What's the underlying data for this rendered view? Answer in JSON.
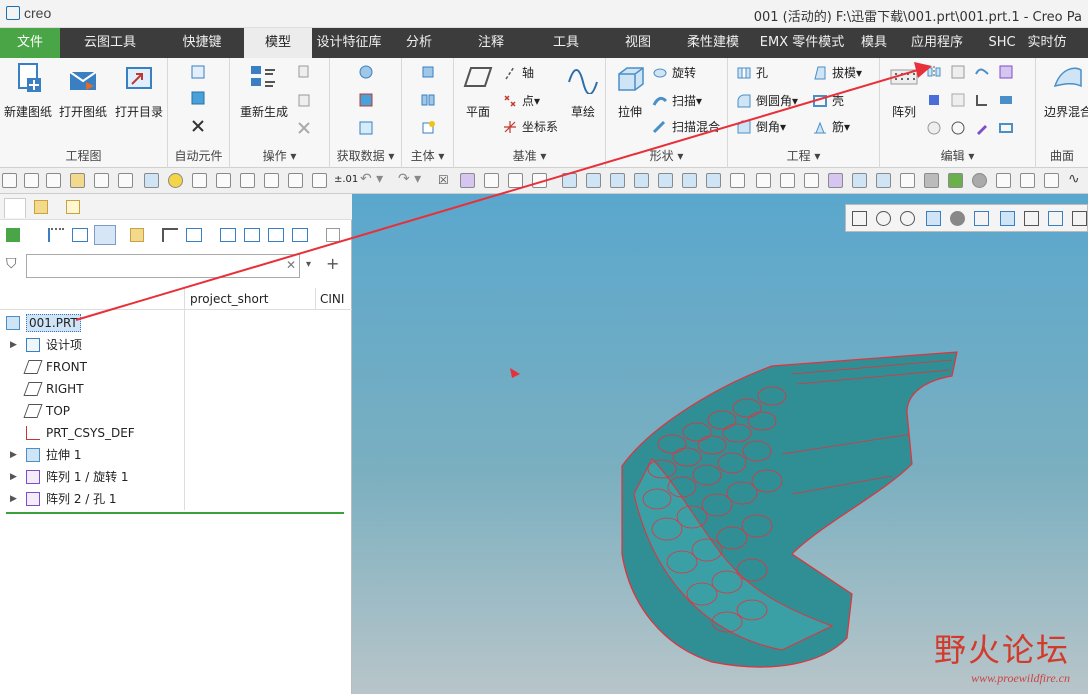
{
  "app": {
    "logo_text": "creo",
    "window_title": "001 (活动的) F:\\迅雷下载\\001.prt\\001.prt.1 - Creo Pa"
  },
  "tabs": [
    {
      "label": "文件"
    },
    {
      "label": "云图工具"
    },
    {
      "label": "快捷键"
    },
    {
      "label": "模型"
    },
    {
      "label": "设计特征库"
    },
    {
      "label": "分析"
    },
    {
      "label": "注释"
    },
    {
      "label": "工具"
    },
    {
      "label": "视图"
    },
    {
      "label": "柔性建模"
    },
    {
      "label": "EMX 零件模式"
    },
    {
      "label": "模具"
    },
    {
      "label": "应用程序"
    },
    {
      "label": "SHC"
    },
    {
      "label": "实时仿"
    }
  ],
  "ribbon": {
    "drawing": {
      "label": "工程图",
      "new": "新建图纸",
      "open": "打开图纸",
      "dir": "打开目录"
    },
    "auto": {
      "label": "自动元件"
    },
    "ops": {
      "label": "操作",
      "regen": "重新生成"
    },
    "getdata": {
      "label": "获取数据"
    },
    "body": {
      "label": "主体"
    },
    "datum": {
      "label": "基准",
      "plane": "平面",
      "axis": "轴",
      "point": "点",
      "csys": "坐标系",
      "sketch": "草绘"
    },
    "shapes": {
      "label": "形状",
      "extrude": "拉伸",
      "revolve": "旋转",
      "sweep": "扫描",
      "swept_blend": "扫描混合"
    },
    "eng": {
      "label": "工程",
      "hole": "孔",
      "round": "倒圆角",
      "chamfer": "倒角",
      "draft": "拔模",
      "shell": "壳",
      "rib": "筋"
    },
    "edit": {
      "label": "编辑",
      "pattern": "阵列"
    },
    "surface": {
      "label": "曲面",
      "boundary": "边界混合"
    }
  },
  "toolbar2": {
    "regen_val": "±.01"
  },
  "leftpane": {
    "filter_placeholder": "",
    "columns": [
      "project_short",
      "CINI"
    ],
    "tree": [
      {
        "label": "001.PRT"
      },
      {
        "label": "设计项"
      },
      {
        "label": "FRONT"
      },
      {
        "label": "RIGHT"
      },
      {
        "label": "TOP"
      },
      {
        "label": "PRT_CSYS_DEF"
      },
      {
        "label": "拉伸 1"
      },
      {
        "label": "阵列 1 / 旋转 1"
      },
      {
        "label": "阵列 2 / 孔 1"
      }
    ]
  },
  "watermark": {
    "main": "野火论坛",
    "sub": "www.proewildfire.cn"
  },
  "colors": {
    "file_tab": "#4aa546",
    "model_fill": "#2f8f95",
    "model_edges": "#e8303a",
    "viewport_top": "#5aa7cd"
  }
}
